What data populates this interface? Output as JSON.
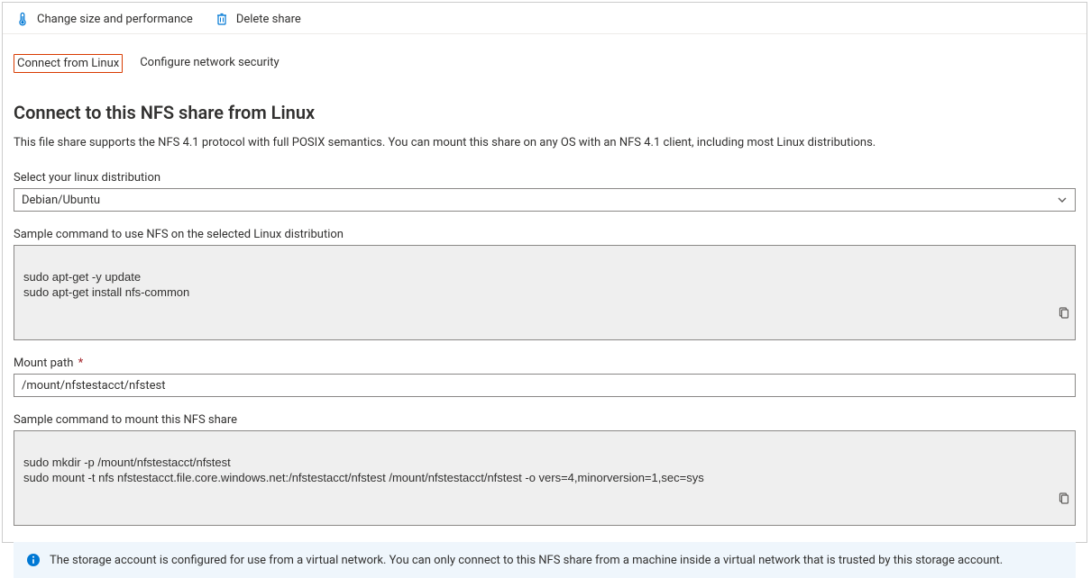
{
  "toolbar": {
    "change_size_label": "Change size and performance",
    "delete_label": "Delete share"
  },
  "tabs": {
    "connect_linux": "Connect from Linux",
    "configure_security": "Configure network security"
  },
  "heading": "Connect to this NFS share from Linux",
  "description": "This file share supports the NFS 4.1 protocol with full POSIX semantics. You can mount this share on any OS with an NFS 4.1 client, including most Linux distributions.",
  "distro": {
    "label": "Select your linux distribution",
    "selected": "Debian/Ubuntu"
  },
  "sample_install": {
    "label": "Sample command to use NFS on the selected Linux distribution",
    "code": "sudo apt-get -y update\nsudo apt-get install nfs-common"
  },
  "mount_path": {
    "label": "Mount path",
    "required": "*",
    "value": "/mount/nfstestacct/nfstest"
  },
  "sample_mount": {
    "label": "Sample command to mount this NFS share",
    "code": "sudo mkdir -p /mount/nfstestacct/nfstest\nsudo mount -t nfs nfstestacct.file.core.windows.net:/nfstestacct/nfstest /mount/nfstestacct/nfstest -o vers=4,minorversion=1,sec=sys"
  },
  "info_message": "The storage account is configured for use from a virtual network. You can only connect to this NFS share from a machine inside a virtual network that is trusted by this storage account."
}
